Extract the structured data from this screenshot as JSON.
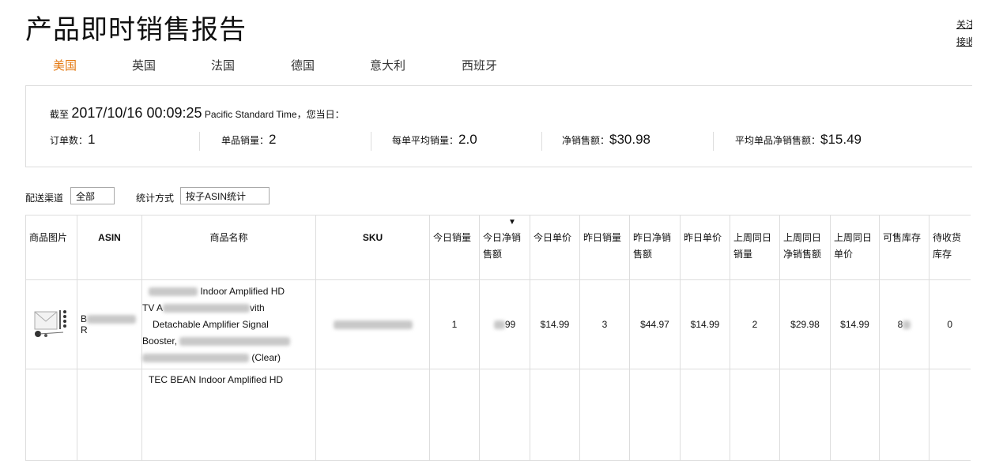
{
  "page": {
    "title": "产品即时销售报告",
    "right_links": [
      "关注",
      "接收"
    ]
  },
  "tabs": [
    "美国",
    "英国",
    "法国",
    "德国",
    "意大利",
    "西班牙"
  ],
  "active_tab": "美国",
  "colors": {
    "active_tab": "#e47911",
    "border": "#dddddd"
  },
  "summary": {
    "as_of_prefix": "截至",
    "as_of_datetime": "2017/10/16 00:09:25",
    "timezone": "Pacific Standard Time",
    "as_of_suffix": "，您当日：",
    "metrics": [
      {
        "label": "订单数：",
        "value": "1"
      },
      {
        "label": "单品销量：",
        "value": "2"
      },
      {
        "label": "每单平均销量：",
        "value": "2.0"
      },
      {
        "label": "净销售额：",
        "value": "$30.98"
      },
      {
        "label": "平均单品净销售额：",
        "value": "$15.49"
      }
    ]
  },
  "filters": {
    "channel_label": "配送渠道",
    "channel_value": "全部",
    "stat_label": "统计方式",
    "stat_value": "按子ASIN统计"
  },
  "table": {
    "headers": [
      "商品图片",
      "ASIN",
      "商品名称",
      "SKU",
      "今日销量",
      "今日净销售额",
      "今日单价",
      "昨日销量",
      "昨日净销售额",
      "昨日单价",
      "上周同日销量",
      "上周同日净销售额",
      "上周同日单价",
      "可售库存",
      "待收货库存"
    ],
    "sort_icon": "caret-down-icon",
    "rows": [
      {
        "asin_visible_start": "B",
        "asin_visible_end": "R",
        "name_line1": "Indoor Amplified HD",
        "name_line2_start": "TV A",
        "name_line2_end": "vith",
        "name_line3": "Detachable Amplifier Signal",
        "name_line4": "Booster,",
        "name_line5_end": "(Clear)",
        "today_qty": "1",
        "today_sales_visible": "99",
        "today_price": "$14.99",
        "yday_qty": "3",
        "yday_sales": "$44.97",
        "yday_price": "$14.99",
        "lastweek_qty": "2",
        "lastweek_sales": "$29.98",
        "lastweek_price": "$14.99",
        "stock_visible": "8",
        "inbound": "0"
      },
      {
        "name_line1": "TEC BEAN Indoor Amplified HD"
      }
    ]
  }
}
